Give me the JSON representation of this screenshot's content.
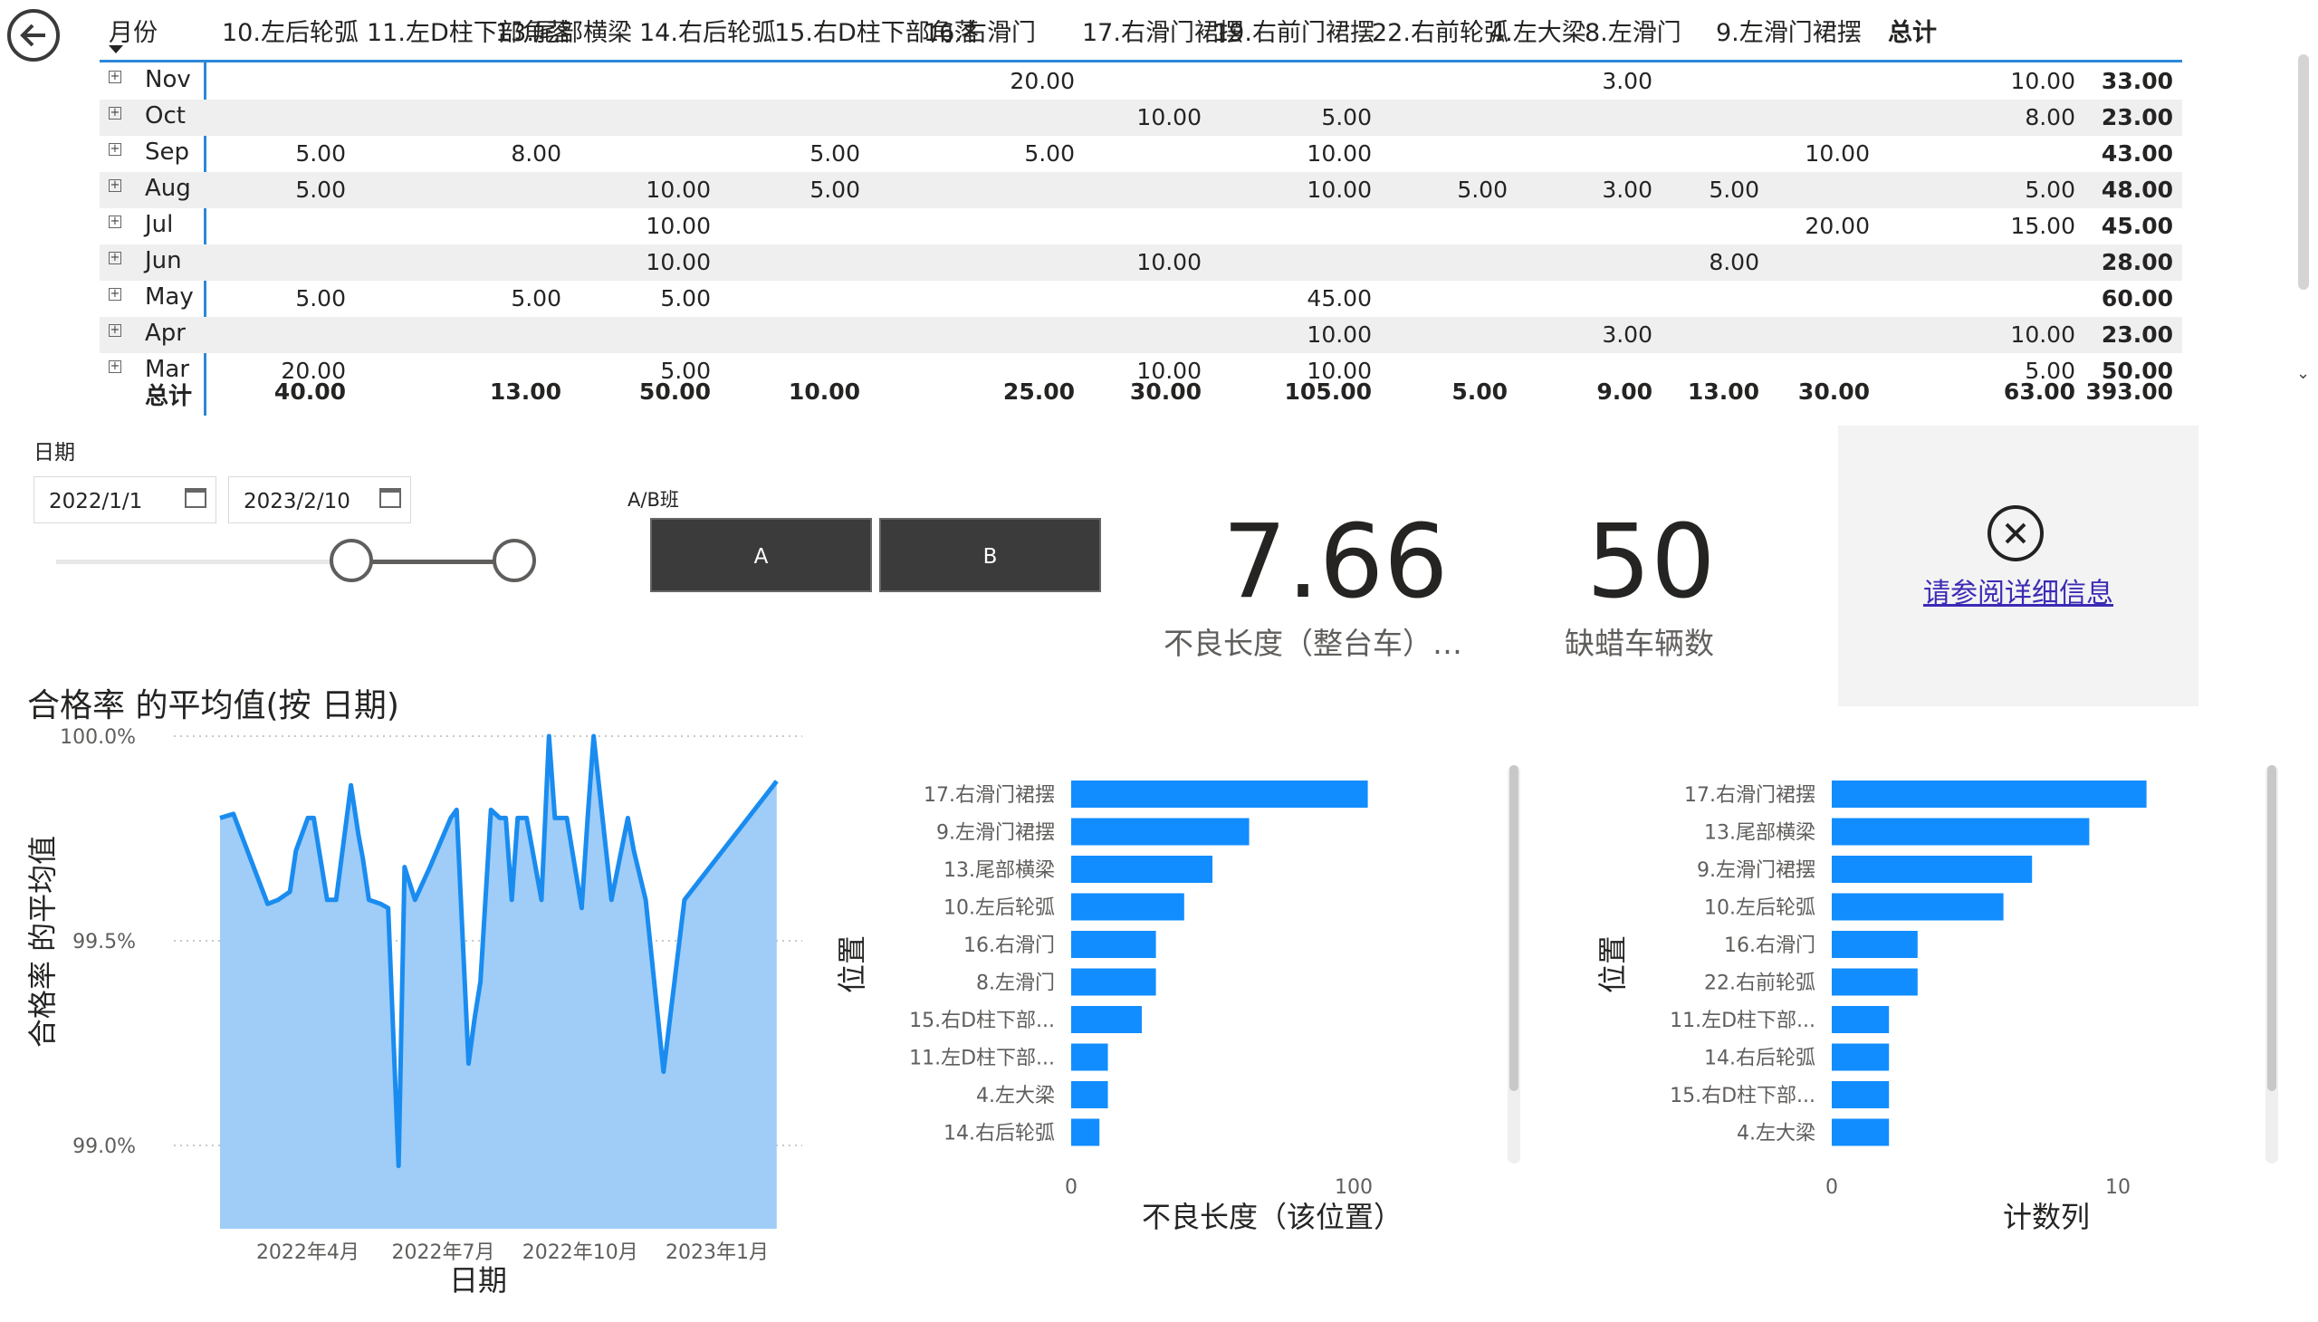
{
  "matrix": {
    "row_header": "月份",
    "columns": [
      "10.左后轮弧",
      "11.左D柱下部角落",
      "13.尾部横梁",
      "14.右后轮弧",
      "15.右D柱下部角落",
      "16.右滑门",
      "17.右滑门裙摆",
      "19.右前门裙摆",
      "22.右前轮弧",
      "4.左大梁",
      "8.左滑门",
      "9.左滑门裙摆",
      "总计"
    ],
    "rows": [
      {
        "label": "Nov",
        "values": [
          "",
          "",
          "",
          "",
          "20.00",
          "",
          "",
          "",
          "3.00",
          "",
          "",
          "10.00",
          "33.00"
        ]
      },
      {
        "label": "Oct",
        "values": [
          "",
          "",
          "",
          "",
          "",
          "10.00",
          "5.00",
          "",
          "",
          "",
          "",
          "8.00",
          "23.00"
        ]
      },
      {
        "label": "Sep",
        "values": [
          "5.00",
          "8.00",
          "",
          "5.00",
          "5.00",
          "",
          "10.00",
          "",
          "",
          "",
          "10.00",
          "",
          "43.00"
        ]
      },
      {
        "label": "Aug",
        "values": [
          "5.00",
          "",
          "10.00",
          "5.00",
          "",
          "",
          "10.00",
          "5.00",
          "3.00",
          "5.00",
          "",
          "5.00",
          "48.00"
        ]
      },
      {
        "label": "Jul",
        "values": [
          "",
          "",
          "10.00",
          "",
          "",
          "",
          "",
          "",
          "",
          "",
          "20.00",
          "15.00",
          "45.00"
        ]
      },
      {
        "label": "Jun",
        "values": [
          "",
          "",
          "10.00",
          "",
          "",
          "10.00",
          "",
          "",
          "",
          "8.00",
          "",
          "",
          "28.00"
        ]
      },
      {
        "label": "May",
        "values": [
          "5.00",
          "5.00",
          "5.00",
          "",
          "",
          "",
          "45.00",
          "",
          "",
          "",
          "",
          "",
          "60.00"
        ]
      },
      {
        "label": "Apr",
        "values": [
          "",
          "",
          "",
          "",
          "",
          "",
          "10.00",
          "",
          "3.00",
          "",
          "",
          "10.00",
          "23.00"
        ]
      },
      {
        "label": "Mar",
        "values": [
          "20.00",
          "",
          "5.00",
          "",
          "",
          "10.00",
          "10.00",
          "",
          "",
          "",
          "",
          "5.00",
          "50.00"
        ]
      }
    ],
    "total_row": {
      "label": "总计",
      "values": [
        "40.00",
        "13.00",
        "50.00",
        "10.00",
        "25.00",
        "30.00",
        "105.00",
        "5.00",
        "9.00",
        "13.00",
        "30.00",
        "63.00",
        "393.00"
      ]
    }
  },
  "date_slicer": {
    "label": "日期",
    "start": "2022/1/1",
    "end": "2023/2/10"
  },
  "shift_slicer": {
    "label": "A/B班",
    "options": [
      "A",
      "B"
    ]
  },
  "cards": [
    {
      "value": "7.66",
      "label": "不良长度（整台车）…"
    },
    {
      "value": "50",
      "label": "缺蜡车辆数"
    }
  ],
  "info": {
    "link_text": "请参阅详细信息"
  },
  "area_chart": {
    "title": "合格率 的平均值(按 日期)",
    "xlabel": "日期",
    "ylabel": "合格率 的平均值",
    "y_ticks": [
      "100.0%",
      "99.5%",
      "99.0%"
    ],
    "x_ticks": [
      "2022年4月",
      "2022年7月",
      "2022年10月",
      "2023年1月"
    ]
  },
  "colors": {
    "accent": "#118dff",
    "area_fill": "#9fcdf7",
    "line": "#1a8cf0",
    "button_dark": "#3b3b3b"
  },
  "chart_data": [
    {
      "type": "area",
      "title": "合格率 的平均值(按 日期)",
      "xlabel": "日期",
      "ylabel": "合格率 的平均值",
      "ylim": [
        98.95,
        100.0
      ],
      "x": [
        "2022-02-01",
        "2022-02-10",
        "2022-03-05",
        "2022-03-12",
        "2022-03-20",
        "2022-03-24",
        "2022-04-01",
        "2022-04-05",
        "2022-04-14",
        "2022-04-20",
        "2022-04-30",
        "2022-05-05",
        "2022-05-08",
        "2022-05-12",
        "2022-05-20",
        "2022-05-25",
        "2022-06-01",
        "2022-06-05",
        "2022-06-12",
        "2022-06-22",
        "2022-07-06",
        "2022-07-10",
        "2022-07-18",
        "2022-07-22",
        "2022-07-26",
        "2022-08-02",
        "2022-08-08",
        "2022-08-12",
        "2022-08-16",
        "2022-08-20",
        "2022-08-26",
        "2022-09-05",
        "2022-09-10",
        "2022-09-14",
        "2022-09-20",
        "2022-09-22",
        "2022-10-02",
        "2022-10-06",
        "2022-10-10",
        "2022-10-16",
        "2022-10-22",
        "2022-11-02",
        "2022-11-06",
        "2022-11-14",
        "2022-11-26",
        "2022-12-10",
        "2023-02-10"
      ],
      "values": [
        99.8,
        99.81,
        99.59,
        99.6,
        99.62,
        99.72,
        99.8,
        99.8,
        99.6,
        99.6,
        99.88,
        99.76,
        99.7,
        99.6,
        99.59,
        99.58,
        98.95,
        99.68,
        99.6,
        99.68,
        99.8,
        99.82,
        99.2,
        99.31,
        99.4,
        99.82,
        99.8,
        99.8,
        99.6,
        99.8,
        99.8,
        99.6,
        100.0,
        99.8,
        99.8,
        99.8,
        99.58,
        99.8,
        100.0,
        99.8,
        99.6,
        99.8,
        99.72,
        99.6,
        99.18,
        99.6,
        99.89,
        99.6
      ]
    },
    {
      "type": "bar",
      "orientation": "horizontal",
      "xlabel": "不良长度（该位置）",
      "ylabel": "位置",
      "xlim": [
        0,
        120
      ],
      "x_ticks": [
        0,
        100
      ],
      "categories": [
        "17.右滑门裙摆",
        "9.左滑门裙摆",
        "13.尾部横梁",
        "10.左后轮弧",
        "16.右滑门",
        "8.左滑门",
        "15.右D柱下部...",
        "11.左D柱下部...",
        "4.左大梁",
        "14.右后轮弧"
      ],
      "values": [
        105,
        63,
        50,
        40,
        30,
        30,
        25,
        13,
        13,
        10
      ]
    },
    {
      "type": "bar",
      "orientation": "horizontal",
      "xlabel": "计数列",
      "ylabel": "位置",
      "xlim": [
        0,
        12
      ],
      "x_ticks": [
        0,
        10
      ],
      "categories": [
        "17.右滑门裙摆",
        "13.尾部横梁",
        "9.左滑门裙摆",
        "10.左后轮弧",
        "16.右滑门",
        "22.右前轮弧",
        "11.左D柱下部...",
        "14.右后轮弧",
        "15.右D柱下部...",
        "4.左大梁"
      ],
      "values": [
        11,
        9,
        7,
        6,
        3,
        3,
        2,
        2,
        2,
        2
      ]
    }
  ]
}
